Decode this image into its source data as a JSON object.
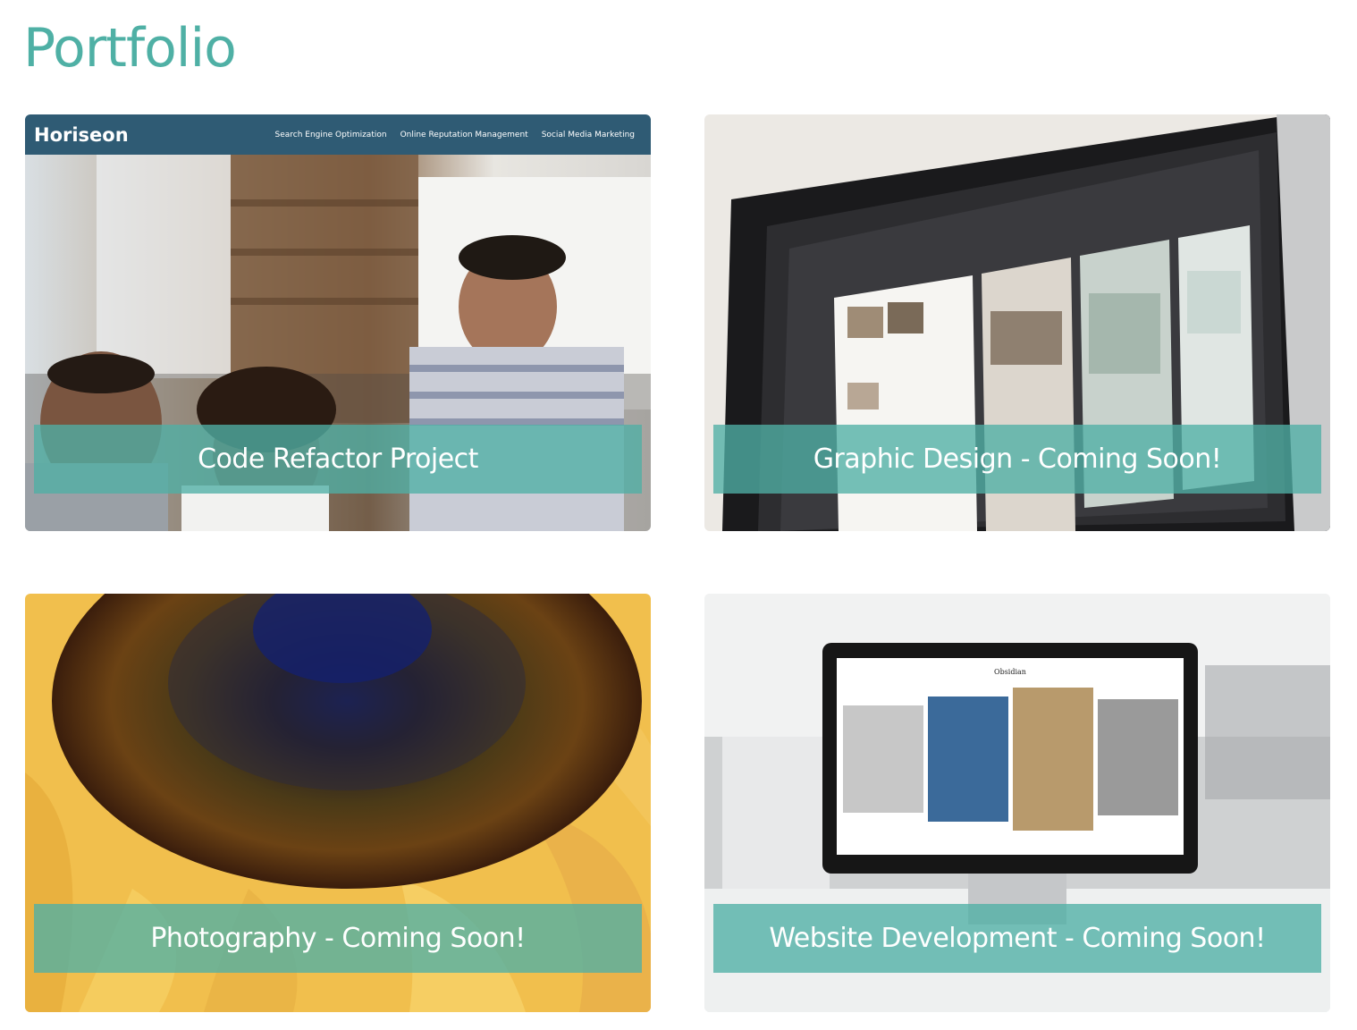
{
  "page": {
    "title": "Portfolio",
    "accent_color": "#4fb0a5",
    "caption_overlay_color": "rgba(79,176,165,0.78)"
  },
  "projects": [
    {
      "caption": "Code Refactor Project",
      "screenshot": {
        "brand": "Horiseon",
        "nav_links": [
          "Search Engine Optimization",
          "Online Reputation Management",
          "Social Media Marketing"
        ],
        "nav_color": "#2f5b74"
      }
    },
    {
      "caption": "Graphic Design - Coming Soon!"
    },
    {
      "caption": "Photography - Coming Soon!"
    },
    {
      "caption": "Website Development - Coming Soon!",
      "screenshot": {
        "site_title": "Obsidian"
      }
    }
  ]
}
